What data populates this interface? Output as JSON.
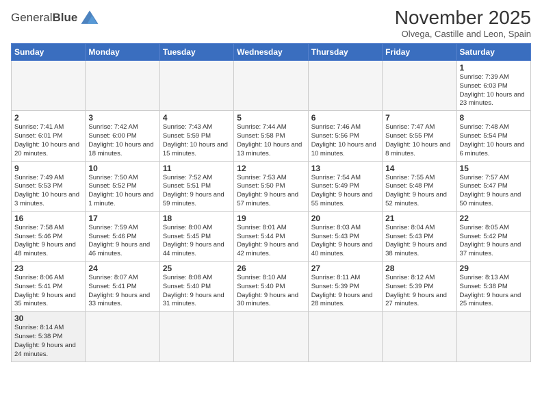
{
  "logo": {
    "text_normal": "General",
    "text_bold": "Blue"
  },
  "header": {
    "month": "November 2025",
    "location": "Olvega, Castille and Leon, Spain"
  },
  "weekdays": [
    "Sunday",
    "Monday",
    "Tuesday",
    "Wednesday",
    "Thursday",
    "Friday",
    "Saturday"
  ],
  "weeks": [
    [
      {
        "day": "",
        "empty": true
      },
      {
        "day": "",
        "empty": true
      },
      {
        "day": "",
        "empty": true
      },
      {
        "day": "",
        "empty": true
      },
      {
        "day": "",
        "empty": true
      },
      {
        "day": "",
        "empty": true
      },
      {
        "day": "1",
        "sunrise": "7:39 AM",
        "sunset": "6:03 PM",
        "daylight": "10 hours and 23 minutes."
      }
    ],
    [
      {
        "day": "2",
        "sunrise": "7:41 AM",
        "sunset": "6:01 PM",
        "daylight": "10 hours and 20 minutes."
      },
      {
        "day": "3",
        "sunrise": "7:42 AM",
        "sunset": "6:00 PM",
        "daylight": "10 hours and 18 minutes."
      },
      {
        "day": "4",
        "sunrise": "7:43 AM",
        "sunset": "5:59 PM",
        "daylight": "10 hours and 15 minutes."
      },
      {
        "day": "5",
        "sunrise": "7:44 AM",
        "sunset": "5:58 PM",
        "daylight": "10 hours and 13 minutes."
      },
      {
        "day": "6",
        "sunrise": "7:46 AM",
        "sunset": "5:56 PM",
        "daylight": "10 hours and 10 minutes."
      },
      {
        "day": "7",
        "sunrise": "7:47 AM",
        "sunset": "5:55 PM",
        "daylight": "10 hours and 8 minutes."
      },
      {
        "day": "8",
        "sunrise": "7:48 AM",
        "sunset": "5:54 PM",
        "daylight": "10 hours and 6 minutes."
      }
    ],
    [
      {
        "day": "9",
        "sunrise": "7:49 AM",
        "sunset": "5:53 PM",
        "daylight": "10 hours and 3 minutes."
      },
      {
        "day": "10",
        "sunrise": "7:50 AM",
        "sunset": "5:52 PM",
        "daylight": "10 hours and 1 minute."
      },
      {
        "day": "11",
        "sunrise": "7:52 AM",
        "sunset": "5:51 PM",
        "daylight": "9 hours and 59 minutes."
      },
      {
        "day": "12",
        "sunrise": "7:53 AM",
        "sunset": "5:50 PM",
        "daylight": "9 hours and 57 minutes."
      },
      {
        "day": "13",
        "sunrise": "7:54 AM",
        "sunset": "5:49 PM",
        "daylight": "9 hours and 55 minutes."
      },
      {
        "day": "14",
        "sunrise": "7:55 AM",
        "sunset": "5:48 PM",
        "daylight": "9 hours and 52 minutes."
      },
      {
        "day": "15",
        "sunrise": "7:57 AM",
        "sunset": "5:47 PM",
        "daylight": "9 hours and 50 minutes."
      }
    ],
    [
      {
        "day": "16",
        "sunrise": "7:58 AM",
        "sunset": "5:46 PM",
        "daylight": "9 hours and 48 minutes."
      },
      {
        "day": "17",
        "sunrise": "7:59 AM",
        "sunset": "5:46 PM",
        "daylight": "9 hours and 46 minutes."
      },
      {
        "day": "18",
        "sunrise": "8:00 AM",
        "sunset": "5:45 PM",
        "daylight": "9 hours and 44 minutes."
      },
      {
        "day": "19",
        "sunrise": "8:01 AM",
        "sunset": "5:44 PM",
        "daylight": "9 hours and 42 minutes."
      },
      {
        "day": "20",
        "sunrise": "8:03 AM",
        "sunset": "5:43 PM",
        "daylight": "9 hours and 40 minutes."
      },
      {
        "day": "21",
        "sunrise": "8:04 AM",
        "sunset": "5:43 PM",
        "daylight": "9 hours and 38 minutes."
      },
      {
        "day": "22",
        "sunrise": "8:05 AM",
        "sunset": "5:42 PM",
        "daylight": "9 hours and 37 minutes."
      }
    ],
    [
      {
        "day": "23",
        "sunrise": "8:06 AM",
        "sunset": "5:41 PM",
        "daylight": "9 hours and 35 minutes."
      },
      {
        "day": "24",
        "sunrise": "8:07 AM",
        "sunset": "5:41 PM",
        "daylight": "9 hours and 33 minutes."
      },
      {
        "day": "25",
        "sunrise": "8:08 AM",
        "sunset": "5:40 PM",
        "daylight": "9 hours and 31 minutes."
      },
      {
        "day": "26",
        "sunrise": "8:10 AM",
        "sunset": "5:40 PM",
        "daylight": "9 hours and 30 minutes."
      },
      {
        "day": "27",
        "sunrise": "8:11 AM",
        "sunset": "5:39 PM",
        "daylight": "9 hours and 28 minutes."
      },
      {
        "day": "28",
        "sunrise": "8:12 AM",
        "sunset": "5:39 PM",
        "daylight": "9 hours and 27 minutes."
      },
      {
        "day": "29",
        "sunrise": "8:13 AM",
        "sunset": "5:38 PM",
        "daylight": "9 hours and 25 minutes."
      }
    ],
    [
      {
        "day": "30",
        "sunrise": "8:14 AM",
        "sunset": "5:38 PM",
        "daylight": "9 hours and 24 minutes."
      },
      {
        "day": "",
        "empty": true
      },
      {
        "day": "",
        "empty": true
      },
      {
        "day": "",
        "empty": true
      },
      {
        "day": "",
        "empty": true
      },
      {
        "day": "",
        "empty": true
      },
      {
        "day": "",
        "empty": true
      }
    ]
  ],
  "labels": {
    "sunrise": "Sunrise:",
    "sunset": "Sunset:",
    "daylight": "Daylight:"
  }
}
